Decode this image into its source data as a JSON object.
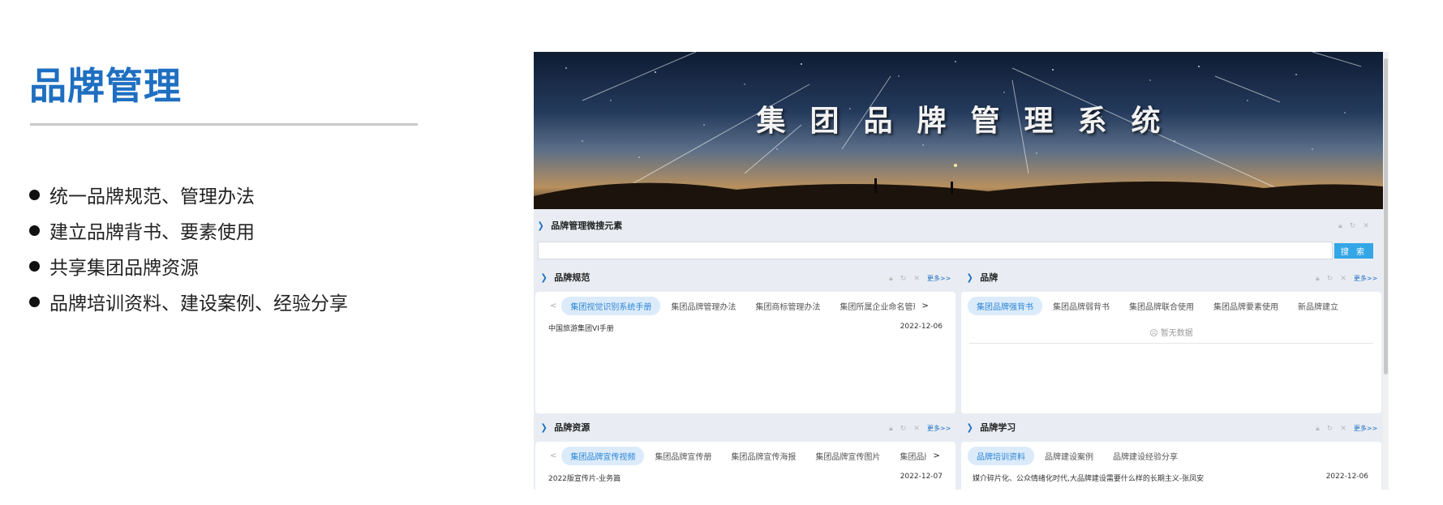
{
  "slide": {
    "title": "品牌管理",
    "bullets": [
      "统一品牌规范、管理办法",
      "建立品牌背书、要素使用",
      "共享集团品牌资源",
      "品牌培训资料、建设案例、经验分享"
    ]
  },
  "banner": {
    "title": "集团品牌管理系统"
  },
  "search_section": {
    "title": "品牌管理微搜元素",
    "input_value": "",
    "button_label": "搜 索"
  },
  "tools": {
    "lock_icon": "lock-icon",
    "refresh_icon": "refresh-icon",
    "close_icon": "close-icon",
    "more_label": "更多>>"
  },
  "panels": {
    "norms": {
      "title": "品牌规范",
      "tabs": [
        "集团视觉识别系统手册",
        "集团品牌管理办法",
        "集团商标管理办法",
        "集团所属企业命名管理"
      ],
      "rows": [
        {
          "name": "中国旅游集团VI手册",
          "date": "2022-12-06"
        }
      ]
    },
    "brand": {
      "title": "品牌",
      "tabs": [
        "集团品牌强背书",
        "集团品牌弱背书",
        "集团品牌联合使用",
        "集团品牌要素使用",
        "新品牌建立"
      ],
      "empty_text": "暂无数据"
    },
    "resources": {
      "title": "品牌资源",
      "tabs": [
        "集团品牌宣传视频",
        "集团品牌宣传册",
        "集团品牌宣传海报",
        "集团品牌宣传图片",
        "集团品牌"
      ],
      "rows": [
        {
          "name": "2022版宣传片-业务篇",
          "date": "2022-12-07"
        }
      ]
    },
    "learning": {
      "title": "品牌学习",
      "tabs": [
        "品牌培训资料",
        "品牌建设案例",
        "品牌建设经验分享"
      ],
      "rows": [
        {
          "name": "媒介碎片化、公众情绪化时代,大品牌建设需要什么样的长期主义-张凤安",
          "date": "2022-12-06"
        }
      ]
    }
  },
  "colors": {
    "accent": "#1f6fc1",
    "tab_active_bg": "#dcebfa",
    "search_button": "#33a6e6"
  }
}
